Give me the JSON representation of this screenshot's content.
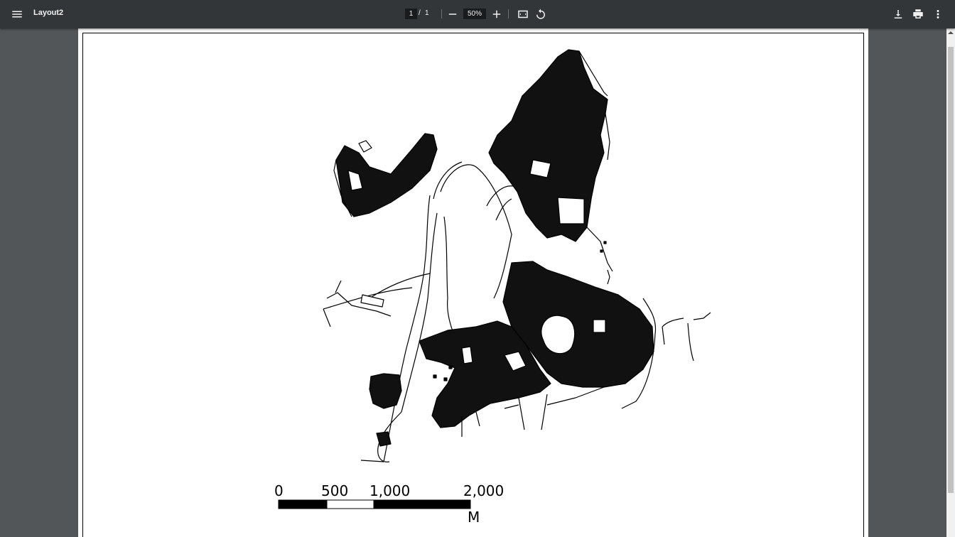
{
  "toolbar": {
    "title": "Layout2",
    "page_current": "1",
    "page_separator": "/",
    "page_total": "1",
    "zoom": "50%",
    "icons": [
      "menu-icon",
      "zoom-out-icon",
      "zoom-in-icon",
      "fit-page-icon",
      "rotate-icon",
      "download-icon",
      "print-icon",
      "more-vert-icon"
    ]
  },
  "map": {
    "scale_labels": [
      "0",
      "500",
      "1,000",
      "2,000"
    ],
    "unit": "M"
  },
  "colors": {
    "toolbar_bg": "#323639",
    "viewer_bg": "#525659",
    "page_bg": "#ffffff",
    "ink": "#000000"
  }
}
